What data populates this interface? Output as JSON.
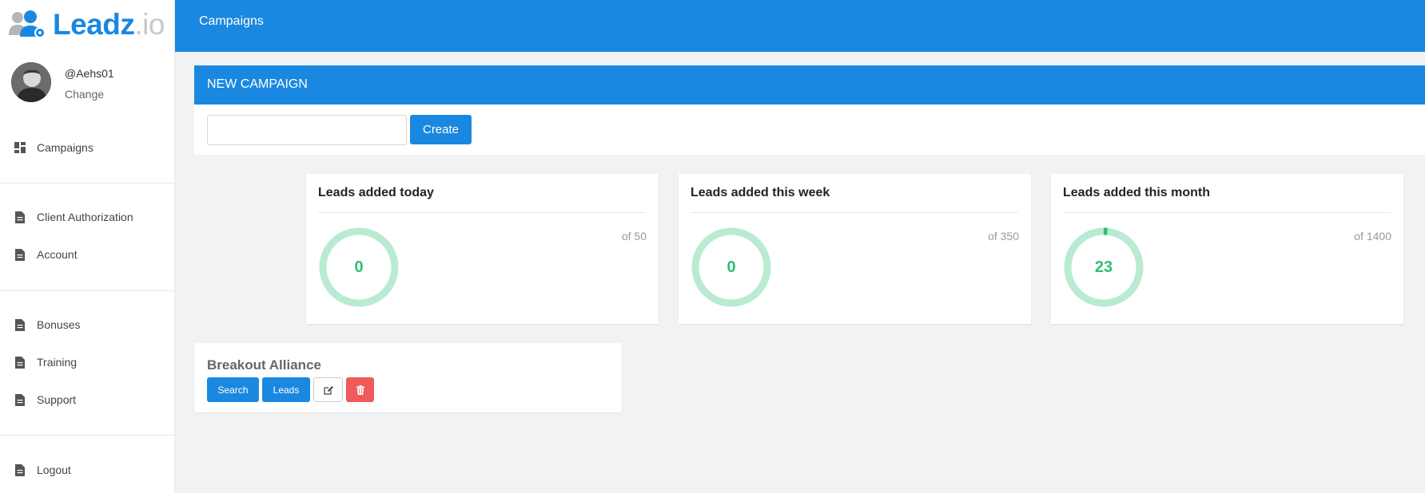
{
  "brand": {
    "name_main": "Leadz",
    "name_suffix": ".io",
    "color": "#1a88e0"
  },
  "profile": {
    "username": "@Aehs01",
    "change_label": "Change"
  },
  "sidebar": {
    "items": [
      {
        "label": "Campaigns",
        "icon": "dashboard-icon"
      },
      {
        "label": "Client Authorization",
        "icon": "document-icon"
      },
      {
        "label": "Account",
        "icon": "document-icon"
      },
      {
        "label": "Bonuses",
        "icon": "document-icon"
      },
      {
        "label": "Training",
        "icon": "document-icon"
      },
      {
        "label": "Support",
        "icon": "document-icon"
      },
      {
        "label": "Logout",
        "icon": "document-icon"
      }
    ]
  },
  "topbar": {
    "title": "Campaigns"
  },
  "new_campaign": {
    "header": "NEW CAMPAIGN",
    "input_value": "",
    "create_label": "Create"
  },
  "stats": [
    {
      "title": "Leads added today",
      "value": "0",
      "limit": "of 50",
      "fraction": 0
    },
    {
      "title": "Leads added this week",
      "value": "0",
      "limit": "of 350",
      "fraction": 0
    },
    {
      "title": "Leads added this month",
      "value": "23",
      "limit": "of 1400",
      "fraction": 0.0164
    }
  ],
  "campaign": {
    "name": "Breakout Alliance",
    "search_label": "Search",
    "leads_label": "Leads",
    "edit_icon": "edit-icon",
    "delete_icon": "trash-icon"
  },
  "colors": {
    "accent": "#1a88e0",
    "success": "#2fbf6f",
    "ring_track": "#b8ebd2",
    "danger": "#f05a5a"
  }
}
